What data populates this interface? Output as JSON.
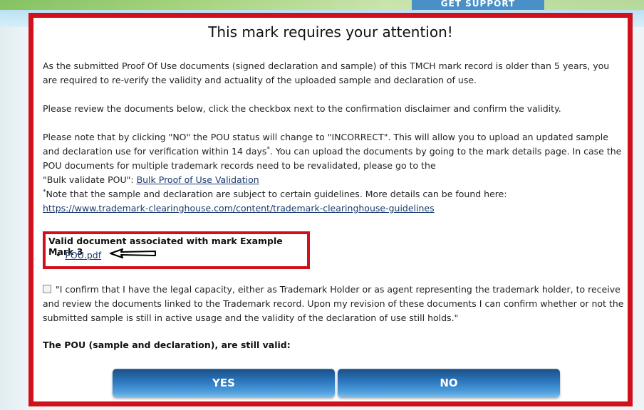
{
  "background": {
    "tab_label": "GET SUPPORT"
  },
  "modal": {
    "title": "This mark requires your attention!",
    "para1": "As the submitted Proof Of Use documents (signed declaration and sample) of this TMCH mark record is older than 5 years, you are required to re-verify the validity and actuality of the uploaded sample and declaration of use.",
    "para2": "Please review the documents below, click the checkbox next to the confirmation disclaimer and confirm the validity.",
    "para3_part1": "Please note that by clicking \"NO\" the POU status will change to \"INCORRECT\". This will allow you to upload an updated sample and declaration use for verification within 14 days",
    "para3_sup": "*",
    "para3_part2": ". You can upload the documents by going to the mark details page. In case the POU documents for multiple trademark records need to be revalidated, please go to the",
    "bulk_prefix": "\"Bulk validate POU\": ",
    "bulk_link": "Bulk Proof of Use Validation",
    "note_sup": "*",
    "note_text": "Note that the sample and declaration are subject to certain guidelines. More details can be found here:",
    "guidelines_link": "https://www.trademark-clearinghouse.com/content/trademark-clearinghouse-guidelines",
    "documents": {
      "label": "Valid document associated with mark Example Mark 3",
      "items": [
        "POU.pdf"
      ]
    },
    "confirm_text": "\"I confirm that I have the legal capacity, either as Trademark Holder or as agent representing the trademark holder, to receive and review the documents linked to the Trademark record. Upon my revision of these documents I can confirm whether or not the submitted sample is still in active usage and the validity of the declaration of use still holds.\"",
    "question": "The POU (sample and declaration), are still valid:",
    "yes_label": "YES",
    "no_label": "NO"
  },
  "colors": {
    "highlight_border": "#d0101a",
    "button_blue": "#2d78bf",
    "link": "#1a3a6e"
  }
}
